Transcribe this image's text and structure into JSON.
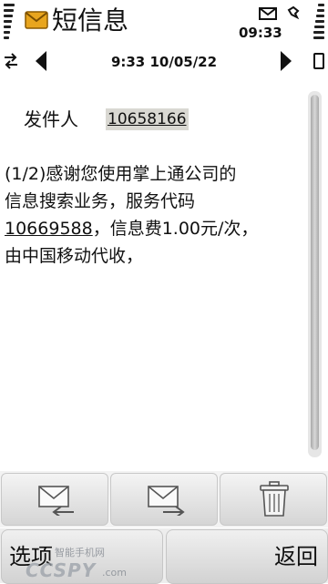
{
  "status": {
    "title": "短信息",
    "time": "09:33",
    "icons": [
      "signal-strength-icon",
      "message-icon",
      "envelope-icon",
      "silent-mode-icon",
      "battery-icon"
    ]
  },
  "nav": {
    "datetime": "9:33 10/05/22",
    "icons": [
      "connection-icon",
      "previous-arrow-icon",
      "next-arrow-icon",
      "battery-small-icon"
    ]
  },
  "message": {
    "sender_label": "发件人",
    "sender_number": "10658166",
    "body_line1": "(1/2)感谢您使用掌上通公司的",
    "body_line2": "信息搜索业务，服务代码",
    "body_code": "10669588",
    "body_line3_rest": "，信息费1.00元/次，",
    "body_line4": "由中国移动代收，"
  },
  "toolbar": {
    "reply_icon": "reply-envelope-icon",
    "forward_icon": "forward-envelope-icon",
    "delete_icon": "trash-icon"
  },
  "softkeys": {
    "left_label": "选项",
    "right_label": "返回"
  },
  "watermark": {
    "top": "智能手机网",
    "main": "CCSPY",
    "suffix": ".com"
  }
}
